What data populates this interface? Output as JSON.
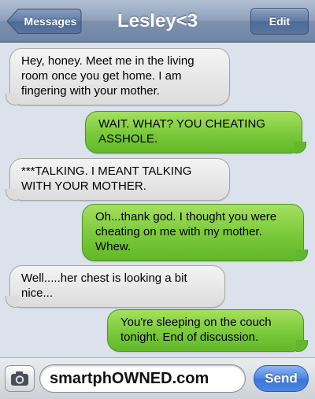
{
  "navbar": {
    "back_label": "Messages",
    "title": "Lesley<3",
    "edit_label": "Edit"
  },
  "messages": [
    {
      "direction": "received",
      "text": "Hey, honey. Meet me in the living room once you get home. I am fingering with your mother."
    },
    {
      "direction": "sent",
      "text": "WAIT. WHAT? YOU CHEATING ASSHOLE."
    },
    {
      "direction": "received",
      "text": "***TALKING. I MEANT TALKING WITH YOUR MOTHER."
    },
    {
      "direction": "sent",
      "text": "Oh...thank god. I thought you were cheating on me with my mother. Whew."
    },
    {
      "direction": "received",
      "text": "Well.....her chest is looking a bit nice..."
    },
    {
      "direction": "sent",
      "text": "You're sleeping on the couch tonight. End of discussion."
    }
  ],
  "input_bar": {
    "camera_icon": "camera-icon",
    "text_value": "smartphOWNED.com",
    "send_label": "Send"
  },
  "colors": {
    "navbar": "#7d91ae",
    "sent_bubble": "#79c93a",
    "received_bubble": "#e8e8e8",
    "background": "#dbe2ec",
    "send_button": "#4c84e0"
  }
}
